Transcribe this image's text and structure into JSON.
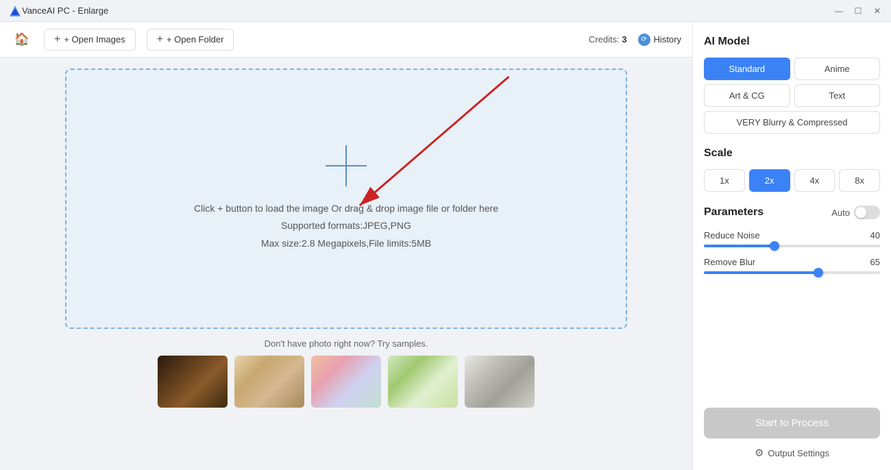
{
  "titlebar": {
    "title": "VanceAI PC - Enlarge",
    "controls": {
      "minimize": "—",
      "maximize": "☐",
      "close": "✕"
    }
  },
  "toolbar": {
    "home_label": "🏠",
    "open_images_label": "+ Open Images",
    "open_folder_label": "+ Open Folder",
    "credits_label": "Credits:",
    "credits_value": "3",
    "history_label": "History"
  },
  "dropzone": {
    "main_text": "Click + button to load the image Or drag & drop image file or folder here",
    "formats_text": "Supported formats:JPEG,PNG",
    "size_text": "Max size:2.8 Megapixels,File limits:5MB"
  },
  "samples": {
    "label": "Don't have photo right now? Try samples."
  },
  "right_panel": {
    "ai_model_title": "AI Model",
    "models": [
      {
        "id": "standard",
        "label": "Standard",
        "active": true
      },
      {
        "id": "anime",
        "label": "Anime",
        "active": false
      },
      {
        "id": "art-cg",
        "label": "Art & CG",
        "active": false
      },
      {
        "id": "text",
        "label": "Text",
        "active": false
      },
      {
        "id": "very-blurry",
        "label": "VERY Blurry & Compressed",
        "active": false,
        "wide": true
      }
    ],
    "scale_title": "Scale",
    "scales": [
      {
        "id": "1x",
        "label": "1x",
        "active": false
      },
      {
        "id": "2x",
        "label": "2x",
        "active": true
      },
      {
        "id": "4x",
        "label": "4x",
        "active": false
      },
      {
        "id": "8x",
        "label": "8x",
        "active": false
      }
    ],
    "parameters_title": "Parameters",
    "auto_label": "Auto",
    "reduce_noise_label": "Reduce Noise",
    "reduce_noise_value": "40",
    "reduce_noise_percent": 40,
    "remove_blur_label": "Remove Blur",
    "remove_blur_value": "65",
    "remove_blur_percent": 65,
    "start_btn_label": "Start to Process",
    "output_settings_label": "Output Settings"
  }
}
